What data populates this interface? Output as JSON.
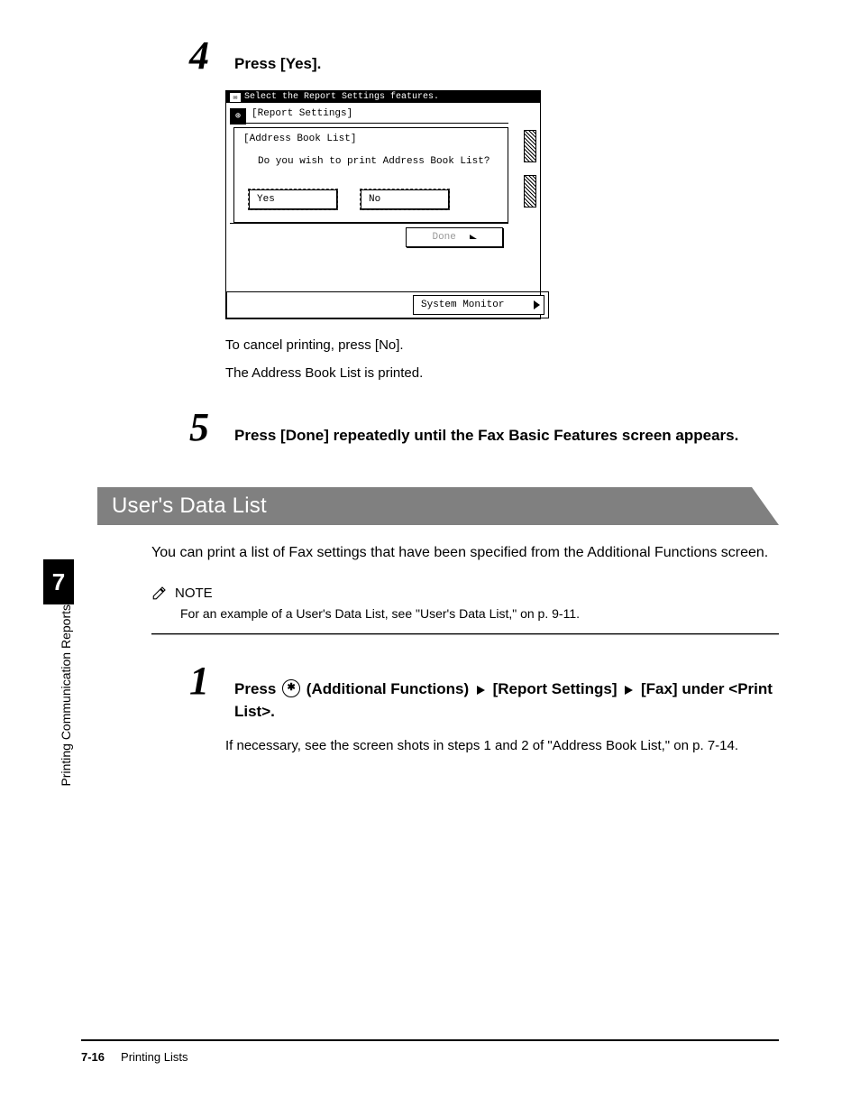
{
  "side": {
    "chapter": "7",
    "label": "Printing Communication Reports"
  },
  "step4": {
    "num": "4",
    "instruction": "Press [Yes].",
    "cancel": "To cancel printing, press [No].",
    "printed": "The Address Book List is printed."
  },
  "screen": {
    "title": "Select the Report Settings features.",
    "breadcrumb": "[Report Settings]",
    "dialog_title": "[Address Book List]",
    "message": "Do you wish to print Address Book List?",
    "yes": "Yes",
    "no": "No",
    "done": "Done",
    "sysmon": "System Monitor"
  },
  "step5": {
    "num": "5",
    "instruction": "Press [Done] repeatedly until the Fax Basic Features screen appears."
  },
  "section": {
    "title": "User's Data List"
  },
  "intro": "You can print a list of Fax settings that have been specified from the Additional Functions screen.",
  "note": {
    "label": "NOTE",
    "text": "For an example of a User's Data List, see \"User's Data List,\" on p. 9-11."
  },
  "step1": {
    "num": "1",
    "prefix": "Press ",
    "af": "(Additional Functions)",
    "rs": "[Report Settings]",
    "fax": "[Fax]",
    "suffix": "under <Print List>.",
    "body": "If necessary, see the screen shots in steps 1 and 2 of \"Address Book List,\" on p. 7-14."
  },
  "footer": {
    "page": "7-16",
    "title": "Printing Lists"
  }
}
